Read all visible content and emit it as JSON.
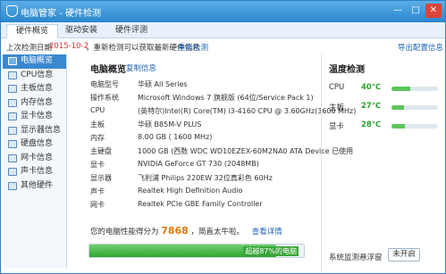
{
  "window": {
    "title": "电脑管家 - 硬件检测",
    "btn_min": "—",
    "btn_max": "□",
    "btn_close": "✕"
  },
  "tabs": [
    {
      "label": "硬件概览"
    },
    {
      "label": "驱动安装"
    },
    {
      "label": "硬件评测"
    }
  ],
  "infobar": {
    "prefix": "上次检测日期",
    "date": "2015-10-2",
    "middle": "，重新检测可以获取最新硬件信息",
    "recheck": "重新检测",
    "export": "导出配置信息"
  },
  "sidebar": {
    "items": [
      {
        "label": "电脑概览"
      },
      {
        "label": "CPU信息"
      },
      {
        "label": "主板信息"
      },
      {
        "label": "内存信息"
      },
      {
        "label": "显卡信息"
      },
      {
        "label": "显示器信息"
      },
      {
        "label": "硬盘信息"
      },
      {
        "label": "网卡信息"
      },
      {
        "label": "声卡信息"
      },
      {
        "label": "其他硬件"
      }
    ]
  },
  "overview": {
    "title": "电脑概览",
    "copy_link": "复制信息",
    "rows": [
      {
        "label": "电脑型号",
        "value": "华硕 All Series"
      },
      {
        "label": "操作系统",
        "value": "Microsoft Windows 7 旗舰版 (64位/Service Pack 1)"
      },
      {
        "label": "CPU",
        "value": "(英特尔)Intel(R) Core(TM) i3-4160 CPU @ 3.60GHz(3600 MHz)"
      },
      {
        "label": "主板",
        "value": "华硕 B85M-V PLUS"
      },
      {
        "label": "内存",
        "value": "8.00 GB ( 1600 MHz)"
      },
      {
        "label": "主硬盘",
        "value": "1000 GB (西数 WDC WD10EZEX-60M2NA0 ATA Device 已使用"
      },
      {
        "label": "显卡",
        "value": "NVIDIA GeForce GT 730 (2048MB)"
      },
      {
        "label": "显示器",
        "value": "飞利浦 Philips 220EW 32位真彩色 60Hz"
      },
      {
        "label": "声卡",
        "value": "Realtek High Definition Audio"
      },
      {
        "label": "网卡",
        "value": "Realtek PCIe GBE Family Controller"
      }
    ],
    "score_prefix": "您的电脑性能得分为",
    "score_value": "7868",
    "score_suffix": "，简直太牛啦。",
    "details_link": "查看详情",
    "beat_percent": 0.87,
    "beat_label": "超越87%的电脑"
  },
  "temps": {
    "title": "温度检测",
    "items": [
      {
        "label": "CPU",
        "value": "40℃",
        "level": 0.4
      },
      {
        "label": "主板",
        "value": "27℃",
        "level": 0.27
      },
      {
        "label": "显卡",
        "value": "28℃",
        "level": 0.28
      }
    ],
    "monitor_label": "系统监测悬浮窗",
    "toggle_label": "未开启"
  }
}
